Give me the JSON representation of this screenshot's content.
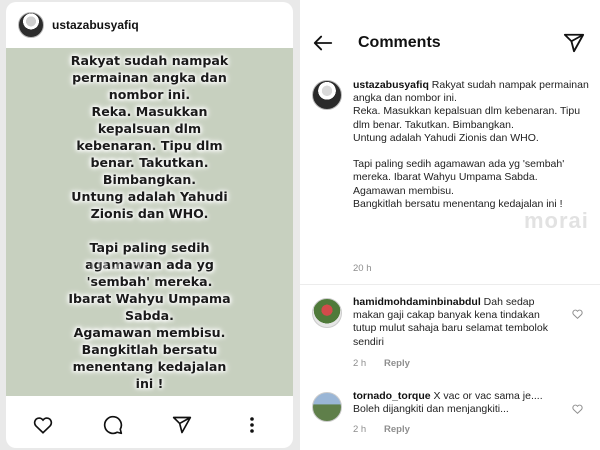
{
  "post": {
    "username": "ustazabusyafiq",
    "image_text": "Rakyat sudah nampak\npermainan angka dan\nnombor ini.\nReka. Masukkan\nkepalsuan dlm\nkebenaran. Tipu dlm\nbenar. Takutkan.\nBimbangkan.\nUntung adalah Yahudi\nZionis dan WHO.\n\nTapi paling sedih\nagamawan ada yg\n'sembah' mereka.\nIbarat Wahyu Umpama\nSabda.\nAgamawan membisu.\nBangkitlah bersatu\nmenentang kedajalan\nini !",
    "watermark": "morai",
    "icons": [
      "heart-icon",
      "comment-icon",
      "share-icon",
      "more-icon"
    ]
  },
  "comments_panel": {
    "title": "Comments",
    "caption": {
      "username": "ustazabusyafiq",
      "text": "Rakyat sudah nampak permainan angka dan nombor ini.\nReka. Masukkan kepalsuan dlm kebenaran. Tipu dlm benar. Takutkan. Bimbangkan.\nUntung adalah Yahudi Zionis dan WHO.\n\nTapi paling sedih agamawan ada yg 'sembah' mereka. Ibarat Wahyu Umpama Sabda.\nAgamawan membisu.\nBangkitlah bersatu menentang kedajalan ini !",
      "time": "20 h"
    },
    "watermark": "morai",
    "comments": [
      {
        "username": "hamidmohdaminbinabdul",
        "text": "Dah sedap makan gaji cakap banyak kena tindakan tutup mulut sahaja baru selamat tembolok sendiri",
        "time": "2 h",
        "reply_label": "Reply"
      },
      {
        "username": "tornado_torque",
        "text": "X vac or vac sama je.... Boleh dijangkiti dan menjangkiti...",
        "time": "2 h",
        "reply_label": "Reply"
      }
    ]
  },
  "colors": {
    "post_bg": "#c7d0bf",
    "meta_gray": "#8e8e8e",
    "page_bg": "#e9e9e9"
  }
}
